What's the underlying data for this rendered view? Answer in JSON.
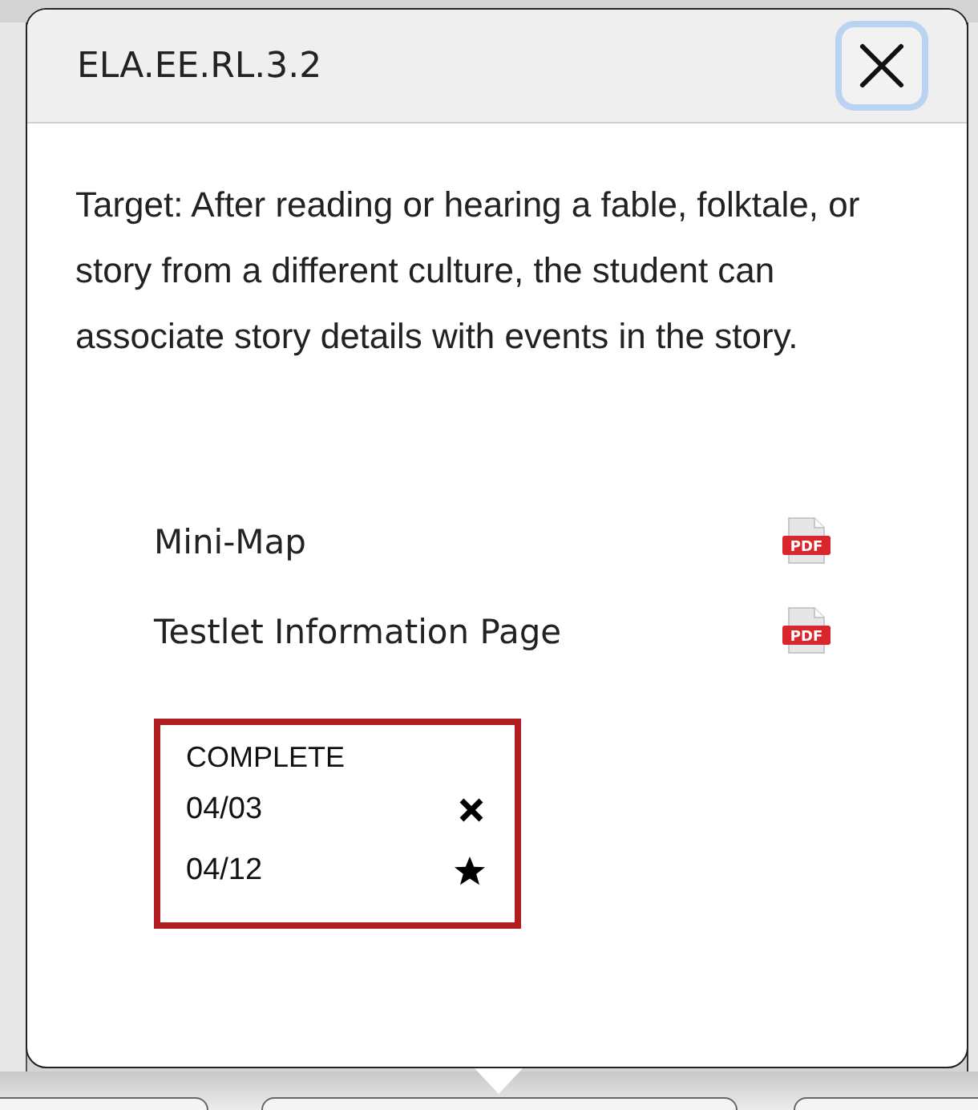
{
  "dialog": {
    "title": "ELA.EE.RL.3.2",
    "target": "Target: After reading or hearing a fable, folktale, or story from a different culture, the student can associate story details with events in the story.",
    "documents": [
      {
        "label": "Mini-Map",
        "icon_text": "PDF"
      },
      {
        "label": "Testlet Information Page",
        "icon_text": "PDF"
      }
    ],
    "status": {
      "heading": "COMPLETE",
      "attempts": [
        {
          "date": "04/03",
          "kind": "cross"
        },
        {
          "date": "04/12",
          "kind": "star"
        }
      ]
    }
  }
}
